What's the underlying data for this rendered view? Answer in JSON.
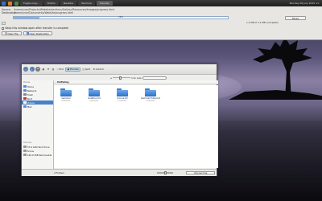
{
  "panel": {
    "tasks": [
      "Fogde.mng…",
      "Firefox",
      "Nautilus",
      "Terminal",
      "Transfer"
    ],
    "clock": "Monday 06 July 2015 11:"
  },
  "transfer": {
    "source_label": "Source:",
    "source_path": "/home/user/Projects/Website/sections/Gallery/Resources/Images/progress.html",
    "destination_label": "Destination:",
    "destination_path": "/home/user/Documents/Website/progress.html",
    "progress_percent": 12,
    "progress_text": "12%",
    "pause_label": "Pause",
    "speed_text": "1.2 MB of 1.4 MB (complete)",
    "keep_label": "Keep this window open after transfer is complete",
    "open_file_label": "Open File",
    "open_destination_label": "Open Destination"
  },
  "filemanager": {
    "toolbar": {
      "find": "Find",
      "preview": "Preview",
      "split": "Split",
      "control": "Control",
      "zoom_label": "Icon size"
    },
    "places_header": "Places",
    "places": [
      {
        "label": "Home",
        "color": "#5c8bd6"
      },
      {
        "label": "Network",
        "color": "#5c8bd6"
      },
      {
        "label": "Trash",
        "color": "#888888"
      },
      {
        "label": "Root",
        "color": "#c0392b"
      },
      {
        "label": "Videos",
        "color": "#4a7fc8"
      },
      {
        "label": "Mail",
        "color": "#5c8bd6"
      }
    ],
    "devices_header": "Devices",
    "devices": [
      {
        "label": "37.6 GiB Hard Drive"
      },
      {
        "label": "Scans"
      },
      {
        "label": "140.0 MiB Removable"
      }
    ],
    "location": "Hoffeling",
    "files": [
      {
        "name": "Gammel",
        "sub": "Unknown"
      },
      {
        "name": "Goethen.txt",
        "sub": "Unknown"
      },
      {
        "name": "Kvinne.txt",
        "sub": "Unknown"
      },
      {
        "name": "Gammel.Folder.txt",
        "sub": "Unknown"
      }
    ],
    "status_text": "4 Folders",
    "free_text": "Unknown free"
  }
}
